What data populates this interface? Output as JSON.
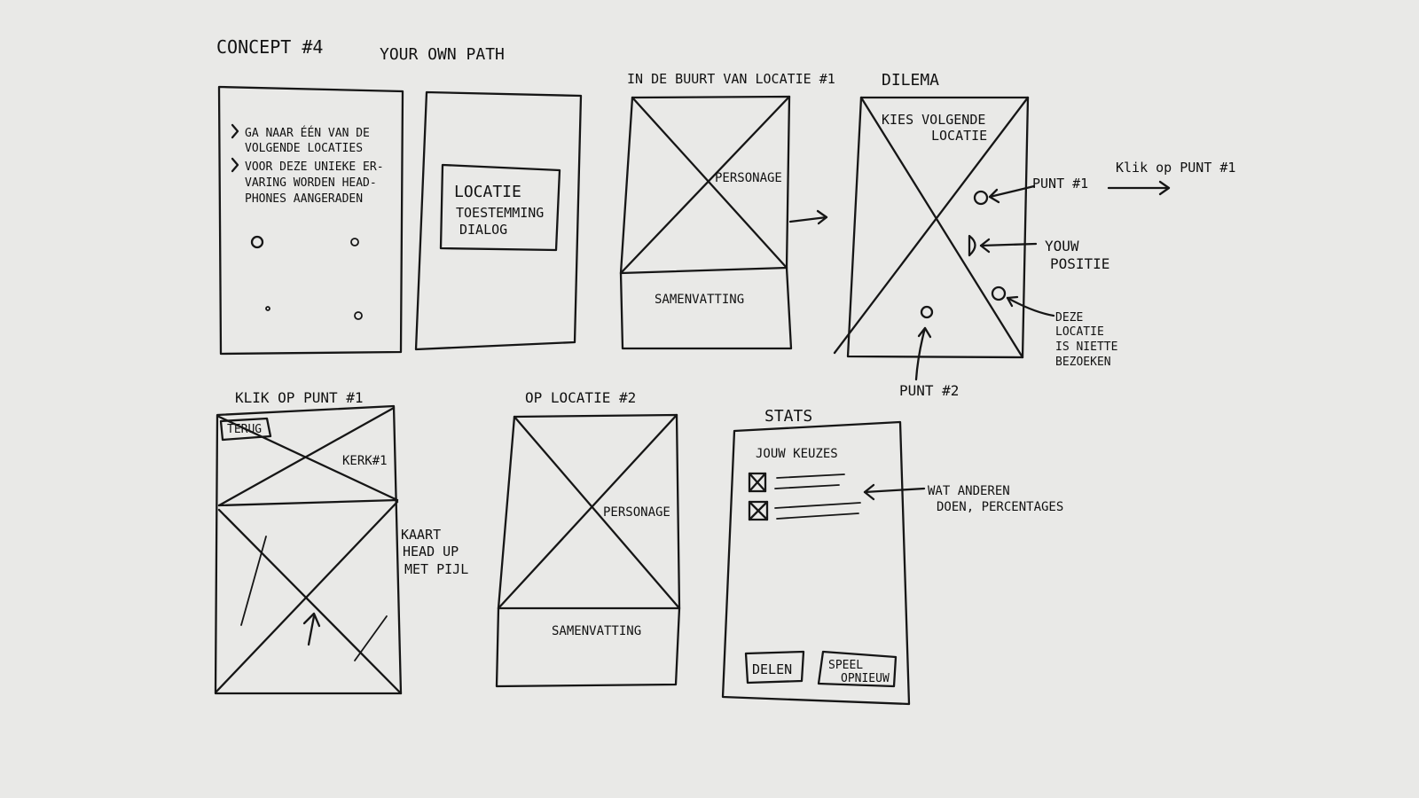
{
  "header": {
    "concept": "CONCEPT #4",
    "subtitle": "YOUR OWN PATH"
  },
  "screen1": {
    "bullets": [
      "GA NAAR ÉÉN VAN DE",
      "VOLGENDE LOCATIES",
      "VOOR DEZE UNIEKE ER-",
      "VARING WORDEN HEAD-",
      "PHONES AANGERADEN"
    ]
  },
  "screen2": {
    "dialog_lines": [
      "LOCATIE",
      "TOESTEMMING",
      "DIALOG"
    ]
  },
  "screen3": {
    "title": "IN DE BUURT VAN LOCATIE #1",
    "character": "PERSONAGE",
    "summary": "SAMENVATTING"
  },
  "screen4": {
    "title": "DILEMA",
    "header_lines": [
      "KIES VOLGENDE",
      "LOCATIE"
    ],
    "point1": "PUNT #1",
    "click_note": "Klik op PUNT #1",
    "your_position": [
      "YOUW",
      "POSITIE"
    ],
    "visited_note": [
      "DEZE",
      "LOCATIE",
      "IS NIETTE",
      "BEZOEKEN"
    ],
    "point2": "PUNT #2"
  },
  "screen5": {
    "title": "KLIK OP PUNT #1",
    "back_button": "TERUG",
    "church": "KERK#1",
    "map_note": [
      "KAART",
      "HEAD UP",
      "MET PIJL"
    ]
  },
  "screen6": {
    "title": "OP LOCATIE #2",
    "character": "PERSONAGE",
    "summary": "SAMENVATTING"
  },
  "screen7": {
    "title": "STATS",
    "choices_label": "JOUW KEUZES",
    "others_note": [
      "WAT ANDEREN",
      "DOEN, PERCENTAGES"
    ],
    "share_button": "DELEN",
    "replay_button": [
      "SPEEL",
      "OPNIEUW"
    ]
  }
}
